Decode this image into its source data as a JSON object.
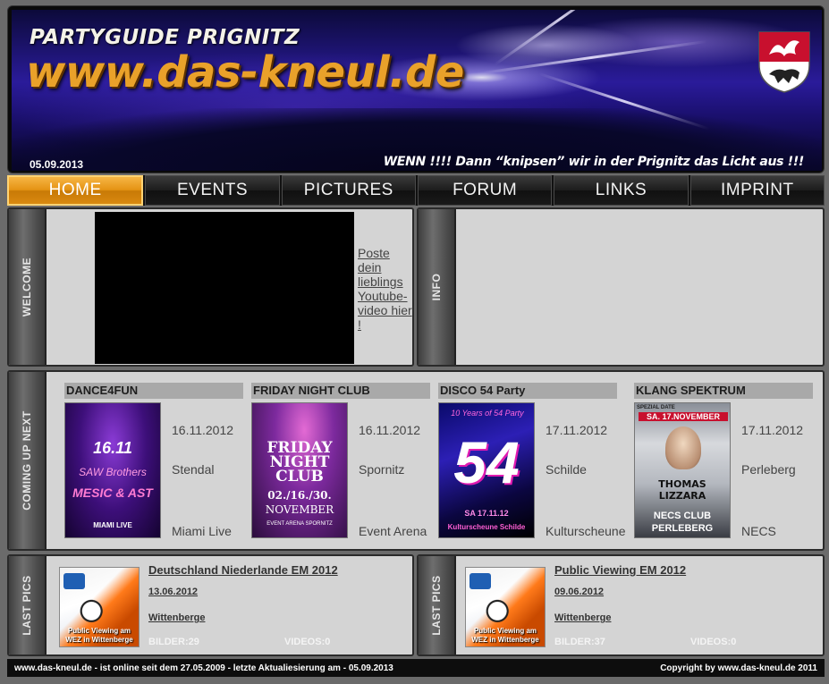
{
  "header": {
    "subtitle": "PARTYGUIDE PRIGNITZ",
    "title": "www.das-kneul.de",
    "date": "05.09.2013",
    "slogan": "WENN !!!! Dann “knipsen” wir in der Prignitz das Licht aus !!!"
  },
  "nav": {
    "items": [
      {
        "label": "HOME",
        "active": true
      },
      {
        "label": "EVENTS"
      },
      {
        "label": "PICTURES"
      },
      {
        "label": "FORUM"
      },
      {
        "label": "LINKS"
      },
      {
        "label": "IMPRINT"
      }
    ]
  },
  "welcome": {
    "label": "WELCOME",
    "video_link": "Poste dein lieblings Youtube-video hier !"
  },
  "info": {
    "label": "INFO"
  },
  "coming_up": {
    "label": "COMING UP NEXT",
    "events": [
      {
        "title": "DANCE4FUN",
        "date": "16.11.2012",
        "place": "Stendal",
        "venue": "Miami Live",
        "flyer_text": [
          "16.11",
          "SAW Brothers",
          "MESIC & AST",
          "MIAMI LIVE"
        ]
      },
      {
        "title": "FRIDAY NIGHT CLUB",
        "date": "16.11.2012",
        "place": "Spornitz",
        "venue": "Event Arena",
        "flyer_text": [
          "FRIDAY",
          "NIGHT",
          "CLUB",
          "02./16./30.",
          "NOVEMBER",
          "EVENT ARENA SPORNITZ"
        ]
      },
      {
        "title": "DISCO 54 Party",
        "date": "17.11.2012",
        "place": "Schilde",
        "venue": "Kulturscheune",
        "flyer_text": [
          "10 Years of 54 Party",
          "54",
          "SA 17.11.12",
          "Kulturscheune Schilde"
        ]
      },
      {
        "title": "KLANG SPEKTRUM",
        "date": "17.11.2012",
        "place": "Perleberg",
        "venue": "NECS",
        "flyer_text": [
          "SPEZIAL DATE",
          "SA. 17.NOVEMBER",
          "THOMAS LIZZARA",
          "NECS CLUB",
          "PERLEBERG"
        ]
      }
    ]
  },
  "last_pics": {
    "label": "LAST PICS",
    "albums": [
      {
        "title": "Deutschland Niederlande EM 2012",
        "date": "13.06.2012",
        "place": "Wittenberge",
        "pictures": "BILDER:29",
        "videos": "VIDEOS:0",
        "thumb_text": "Public Viewing am WEZ in Wittenberge"
      },
      {
        "title": "Public Viewing EM 2012",
        "date": "09.06.2012",
        "place": "Wittenberge",
        "pictures": "BILDER:37",
        "videos": "VIDEOS:0",
        "thumb_text": "Public Viewing am WEZ in Wittenberge"
      }
    ]
  },
  "footer": {
    "left": "www.das-kneul.de - ist online seit dem 27.05.2009 - letzte Aktualiesierung am - 05.09.2013",
    "right": "Copyright by www.das-kneul.de 2011"
  },
  "colors": {
    "accent": "#e59314",
    "panel": "#d4d4d4",
    "page_bg": "#6b6b6b"
  },
  "icons": {
    "crest": "coat-of-arms-icon"
  }
}
